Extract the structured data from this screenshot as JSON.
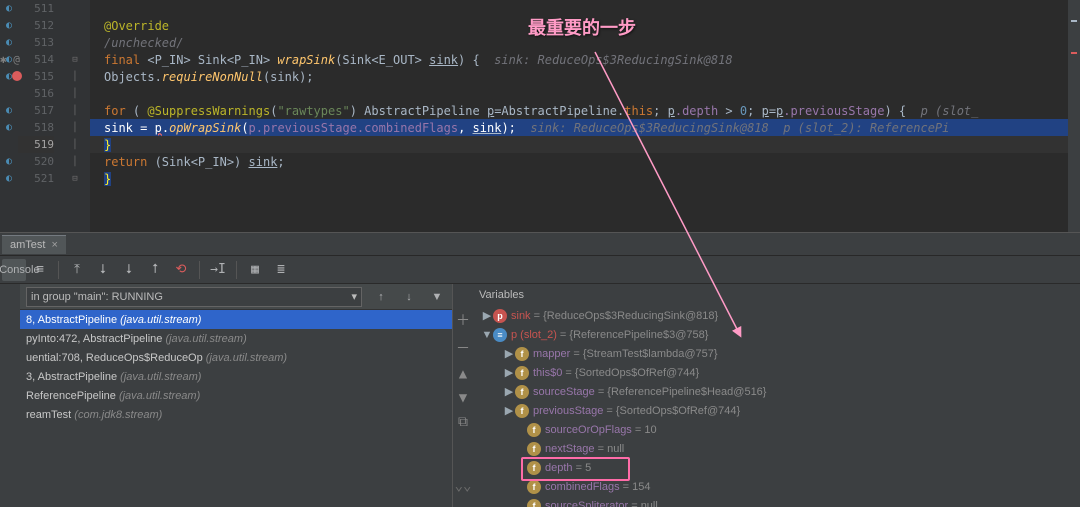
{
  "annotation_text": "最重要的一步",
  "code": {
    "lines": {
      "l511": "",
      "l512_ann": "@Override",
      "l513_ann": "/unchecked/",
      "l514_kw1": "final",
      "l514_gen1": " <P_IN> Sink<P_IN> ",
      "l514_meth": "wrapSink",
      "l514_args": "(Sink<E_OUT> ",
      "l514_p": "sink",
      "l514_end": ") {",
      "l514_hint": "  sink: ReduceOps$3ReducingSink@818",
      "l515_a": "Objects.",
      "l515_b": "requireNonNull",
      "l515_c": "(sink);",
      "l516": "",
      "l517_for": "for",
      "l517_a": " ( ",
      "l517_sw": "@SuppressWarnings",
      "l517_b": "(",
      "l517_str": "\"rawtypes\"",
      "l517_c": ") AbstractPipeline ",
      "l517_p": "p",
      "l517_d": "=AbstractPipeline.",
      "l517_this": "this",
      "l517_e": "; ",
      "l517_p2": "p",
      "l517_dep": ".depth",
      "l517_f": " > ",
      "l517_zero": "0",
      "l517_g": "; ",
      "l517_p3": "p",
      "l517_h": "=",
      "l517_p4": "p",
      "l517_prev": ".previousStage",
      "l517_i": ") {",
      "l517_hint": "  p (slot_",
      "l518_sink": "sink",
      "l518_a": " = ",
      "l518_p": "p",
      "l518_b": ".",
      "l518_op": "opWrapSink",
      "l518_c": "(",
      "l518_p2": "p",
      "l518_prev": ".previousStage.combinedFlags",
      "l518_d": ", ",
      "l518_sink2": "sink",
      "l518_e": ");",
      "l518_hint": "  sink: ReduceOps$3ReducingSink@818  p (slot_2): ReferencePi",
      "l519": "}",
      "l520_ret": "return",
      "l520_a": " (Sink<P_IN>) ",
      "l520_s": "sink",
      "l520_b": ";",
      "l521": "}"
    },
    "line_numbers": [
      "511",
      "512",
      "513",
      "514",
      "515",
      "516",
      "517",
      "518",
      "519",
      "520",
      "521"
    ]
  },
  "tab": {
    "name": "amTest",
    "close": "×"
  },
  "toolbar": {
    "console_label": "Console"
  },
  "thread_combo": " in group \"main\": RUNNING",
  "frames": [
    {
      "text": "8, AbstractPipeline ",
      "loc": "(java.util.stream)"
    },
    {
      "text": "pyInto:472, AbstractPipeline ",
      "loc": "(java.util.stream)"
    },
    {
      "text": "uential:708, ReduceOps$ReduceOp ",
      "loc": "(java.util.stream)"
    },
    {
      "text": "3, AbstractPipeline ",
      "loc": "(java.util.stream)"
    },
    {
      "text": "ReferencePipeline ",
      "loc": "(java.util.stream)"
    },
    {
      "text": "reamTest ",
      "loc": "(com.jdk8.stream)"
    }
  ],
  "vars_header": "Variables",
  "vars": {
    "sink": {
      "name": "sink",
      "val": " = {ReduceOps$3ReducingSink@818}"
    },
    "p": {
      "name": "p (slot_2)",
      "val": " = {ReferencePipeline$3@758}"
    },
    "mapper": {
      "name": "mapper",
      "val": " = {StreamTest$lambda@757}"
    },
    "this0": {
      "name": "this$0",
      "val": " = {SortedOps$OfRef@744}"
    },
    "sourceStage": {
      "name": "sourceStage",
      "val": " = {ReferencePipeline$Head@516}"
    },
    "previousStage": {
      "name": "previousStage",
      "val": " = {SortedOps$OfRef@744}"
    },
    "sourceOrOpFlags": {
      "name": "sourceOrOpFlags",
      "val": " = 10"
    },
    "nextStage": {
      "name": "nextStage",
      "val": " = null"
    },
    "depth": {
      "name": "depth",
      "val": " = 5"
    },
    "combinedFlags": {
      "name": "combinedFlags",
      "val": " = 154"
    },
    "sourceSpliterator": {
      "name": "sourceSpliterator",
      "val": " = null"
    }
  }
}
